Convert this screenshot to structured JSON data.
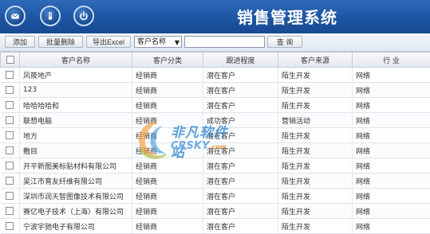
{
  "header": {
    "title": "销售管理系统",
    "icons": [
      "mail-icon",
      "phone-icon",
      "power-icon"
    ]
  },
  "toolbar": {
    "add_label": "添加",
    "batch_delete_label": "批量删除",
    "export_label": "导出Excel",
    "search_field": "客户名称",
    "search_value": "",
    "query_label": "查 询"
  },
  "table": {
    "columns": [
      "客户名称",
      "客户分类",
      "跟进程度",
      "客户来源",
      "行 业"
    ],
    "rows": [
      [
        "风筱地产",
        "经销商",
        "潜在客户",
        "陌生开发",
        "网络"
      ],
      [
        "123",
        "经销商",
        "潜在客户",
        "陌生开发",
        "网络"
      ],
      [
        "哈哈哈哈和",
        "经销商",
        "潜在客户",
        "陌生开发",
        "网络"
      ],
      [
        "联想电脑",
        "经销商",
        "成功客户",
        "营销活动",
        "网络"
      ],
      [
        "地方",
        "经销商",
        "潜在客户",
        "陌生开发",
        "网络"
      ],
      [
        "敷目",
        "经销商",
        "潜在客户",
        "陌生开发",
        "网络"
      ],
      [
        "开平新图美标贴材料有限公司",
        "经销商",
        "潜在客户",
        "陌生开发",
        "网络"
      ],
      [
        "吴江市育友纤维有限公司",
        "经销商",
        "潜在客户",
        "陌生开发",
        "网络"
      ],
      [
        "深圳市润天智图像技术有限公司",
        "经销商",
        "潜在客户",
        "陌生开发",
        "网络"
      ],
      [
        "赛亿电子技术（上海）有限公司",
        "经销商",
        "潜在客户",
        "陌生开发",
        "网络"
      ],
      [
        "宁波宇驰电子有限公司",
        "经销商",
        "潜在客户",
        "陌生开发",
        "网络"
      ]
    ]
  },
  "watermark": {
    "line1": "非凡软件站",
    "line2": "CRSKY",
    "line2_suffix": ".com"
  }
}
